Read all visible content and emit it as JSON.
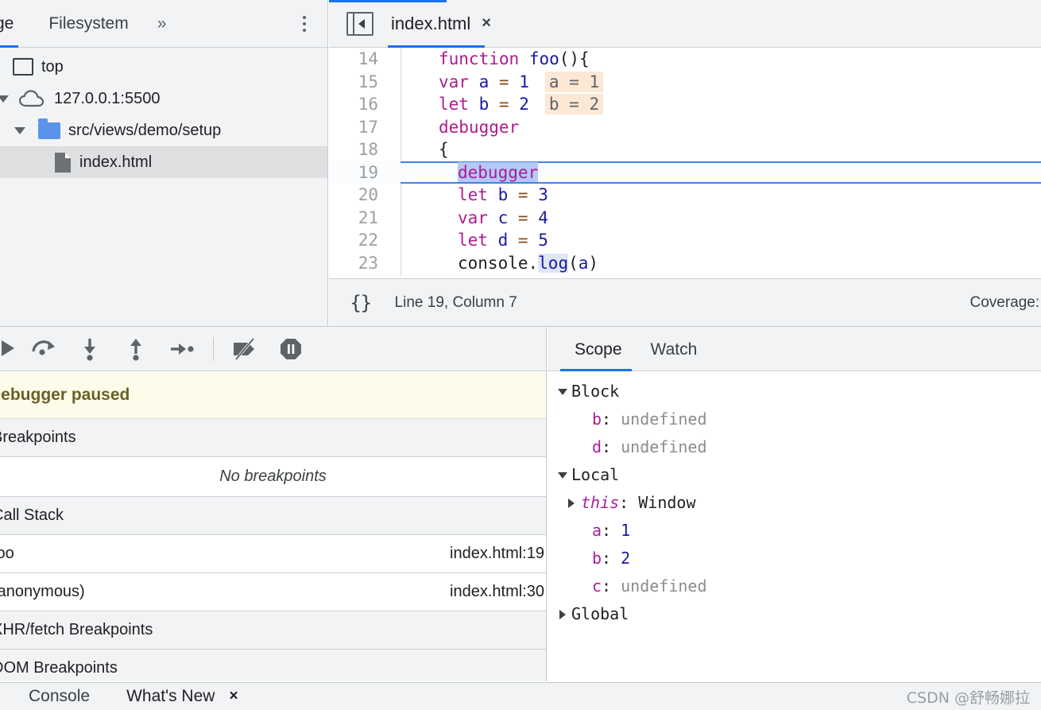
{
  "navigator": {
    "tabs": [
      {
        "label": "ge",
        "name": "tab-page",
        "active": true
      },
      {
        "label": "Filesystem",
        "name": "tab-filesystem",
        "active": false
      }
    ],
    "more_label": "»",
    "tree": [
      {
        "label": "top",
        "icon": "frame-icon",
        "indent": 0
      },
      {
        "label": "127.0.0.1:5500",
        "icon": "cloud-icon",
        "indent": 0
      },
      {
        "label": "src/views/demo/setup",
        "icon": "folder-icon",
        "indent": 1
      },
      {
        "label": "index.html",
        "icon": "file-icon",
        "indent": 2,
        "selected": true
      }
    ]
  },
  "editor": {
    "tab": {
      "label": "index.html",
      "close": "×"
    },
    "lines": [
      {
        "n": "14",
        "indent": 0
      },
      {
        "n": "15",
        "indent": 0,
        "inline": "a = 1"
      },
      {
        "n": "16",
        "indent": 0,
        "inline": "b = 2"
      },
      {
        "n": "17",
        "indent": 0
      },
      {
        "n": "18",
        "indent": 0
      },
      {
        "n": "19",
        "indent": 1,
        "exec": true
      },
      {
        "n": "20",
        "indent": 1
      },
      {
        "n": "21",
        "indent": 1
      },
      {
        "n": "22",
        "indent": 1
      },
      {
        "n": "23",
        "indent": 1
      }
    ],
    "code": {
      "l14": "function foo(){",
      "l15": "var a = 1",
      "l16": "let b = 2",
      "l17": "debugger",
      "l18": "{",
      "l19": "debugger",
      "l20": "let b = 3",
      "l21": "var c = 4",
      "l22": "let d = 5",
      "l23": "console.log(a)"
    },
    "inline_values": {
      "line15": "a = 1",
      "line16": "b = 2"
    },
    "status": {
      "braces": "{}",
      "position": "Line 19, Column 7",
      "coverage": "Coverage: n"
    }
  },
  "debugger_panel": {
    "toolbar_icons": [
      "resume-icon",
      "step-over-icon",
      "step-into-icon",
      "step-out-icon",
      "step-icon",
      "deactivate-breakpoints-icon",
      "pause-on-exceptions-icon"
    ],
    "paused_message": "Debugger paused",
    "sections": {
      "breakpoints_title": "Breakpoints",
      "breakpoints_empty": "No breakpoints",
      "call_stack_title": "Call Stack",
      "xhr_title": "XHR/fetch Breakpoints",
      "dom_title": "DOM Breakpoints"
    },
    "call_stack": [
      {
        "name": "foo",
        "location": "index.html:19"
      },
      {
        "name": "(anonymous)",
        "location": "index.html:30"
      }
    ]
  },
  "scope_panel": {
    "tabs": [
      {
        "label": "Scope",
        "active": true
      },
      {
        "label": "Watch",
        "active": false
      }
    ],
    "scopes": [
      {
        "name": "Block",
        "expanded": true,
        "props": [
          {
            "key": "b",
            "value": "undefined",
            "kind": "undefined"
          },
          {
            "key": "d",
            "value": "undefined",
            "kind": "undefined"
          }
        ]
      },
      {
        "name": "Local",
        "expanded": true,
        "props": [
          {
            "key": "this",
            "value": "Window",
            "kind": "object",
            "italic": true,
            "expandable": true
          },
          {
            "key": "a",
            "value": "1",
            "kind": "number"
          },
          {
            "key": "b",
            "value": "2",
            "kind": "number"
          },
          {
            "key": "c",
            "value": "undefined",
            "kind": "undefined"
          }
        ]
      },
      {
        "name": "Global",
        "expanded": false,
        "props": []
      }
    ]
  },
  "drawer": {
    "tabs": [
      {
        "label": "Console"
      },
      {
        "label": "What's New"
      }
    ],
    "close": "×",
    "watermark": "CSDN @舒畅娜拉"
  },
  "colors": {
    "accent": "#1a73e8",
    "keyword": "#af1a90",
    "number": "#1a1aa6",
    "operator": "#8a4b16",
    "exec_highlight": "#b3c9f7",
    "inline_value_bg": "#fce8d5",
    "paused_bg": "#fdfcea",
    "paused_text": "#6b6026",
    "panel_bg": "#f1f3f4"
  }
}
